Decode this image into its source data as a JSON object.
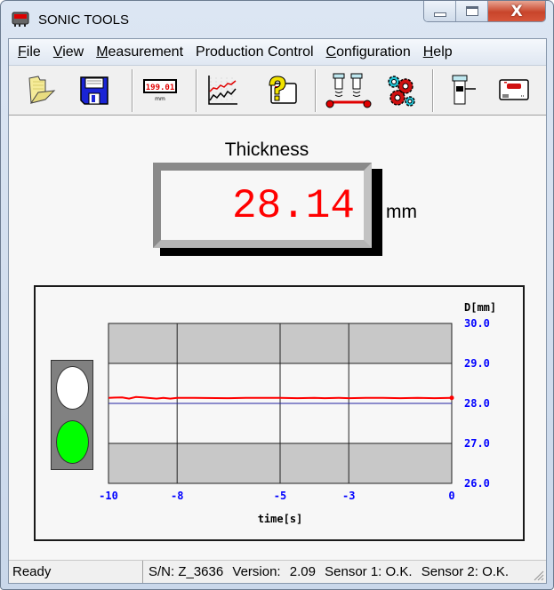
{
  "window": {
    "title": "SONIC TOOLS",
    "controls": {
      "minimize": "minimize",
      "maximize": "maximize",
      "close": "close"
    }
  },
  "menu": [
    {
      "label": "File",
      "accel": "F",
      "rest": "ile"
    },
    {
      "label": "View",
      "accel": "V",
      "rest": "iew"
    },
    {
      "label": "Measurement",
      "accel": "M",
      "rest": "easurement"
    },
    {
      "label": "Production Control",
      "accel": "",
      "rest": "Production Control"
    },
    {
      "label": "Configuration",
      "accel": "C",
      "rest": "onfiguration"
    },
    {
      "label": "Help",
      "accel": "H",
      "rest": "elp"
    }
  ],
  "toolbar": {
    "buttons": [
      {
        "name": "open",
        "icon": "folder-open-icon"
      },
      {
        "name": "save",
        "icon": "floppy-disk-icon"
      },
      {
        "name": "digital-display",
        "icon": "digital-display-icon",
        "display_text": "199.01",
        "unit_text": "mm"
      },
      {
        "name": "trend-chart",
        "icon": "line-chart-icon"
      },
      {
        "name": "device-help",
        "icon": "device-help-icon"
      },
      {
        "name": "production-control",
        "icon": "dual-sensor-conveyor-icon"
      },
      {
        "name": "configuration",
        "icon": "gears-icon"
      },
      {
        "name": "sensor",
        "icon": "ultrasonic-sensor-icon"
      },
      {
        "name": "device",
        "icon": "device-unit-icon"
      }
    ]
  },
  "measurement": {
    "label": "Thickness",
    "value": "28.14",
    "unit": "mm",
    "value_color": "#ff0000"
  },
  "traffic_light": {
    "top": "off",
    "bottom": "green",
    "active_color": "#00ff00"
  },
  "chart_data": {
    "type": "line",
    "title": "",
    "xlabel": "time[s]",
    "ylabel": "D[mm]",
    "xlim": [
      -10,
      0
    ],
    "ylim": [
      26.0,
      30.0
    ],
    "x_ticks": [
      "-10",
      "-8",
      "-5",
      "-3",
      "0"
    ],
    "y_ticks": [
      "30.0",
      "29.0",
      "28.0",
      "27.0",
      "26.0"
    ],
    "tolerance_bands": [
      {
        "from": 29.0,
        "to": 30.0,
        "color": "#c8c8c8"
      },
      {
        "from": 26.0,
        "to": 27.0,
        "color": "#c8c8c8"
      }
    ],
    "reference_line": {
      "value": 28.0,
      "color": "#2020a0"
    },
    "series": [
      {
        "name": "Thickness",
        "color": "#ff0000",
        "x": [
          -10,
          -9.6,
          -9.4,
          -9.2,
          -9.0,
          -8.6,
          -8.4,
          -8.2,
          -8.0,
          -7.5,
          -6.5,
          -6.0,
          -5.5,
          -5.0,
          -4.5,
          -4.0,
          -3.7,
          -3.3,
          -3.0,
          -2.5,
          -2.0,
          -1.5,
          -1.0,
          -0.5,
          0
        ],
        "y": [
          28.14,
          28.15,
          28.12,
          28.16,
          28.15,
          28.12,
          28.14,
          28.12,
          28.14,
          28.14,
          28.13,
          28.14,
          28.14,
          28.14,
          28.13,
          28.14,
          28.13,
          28.14,
          28.13,
          28.14,
          28.14,
          28.13,
          28.14,
          28.13,
          28.14
        ]
      }
    ],
    "grid": true,
    "axis_color": "#0000ff"
  },
  "status": {
    "ready": "Ready",
    "serial": "S/N: Z_3636",
    "version_label": "Version:",
    "version": "2.09",
    "sensor1": "Sensor 1: O.K.",
    "sensor2": "Sensor 2: O.K."
  }
}
